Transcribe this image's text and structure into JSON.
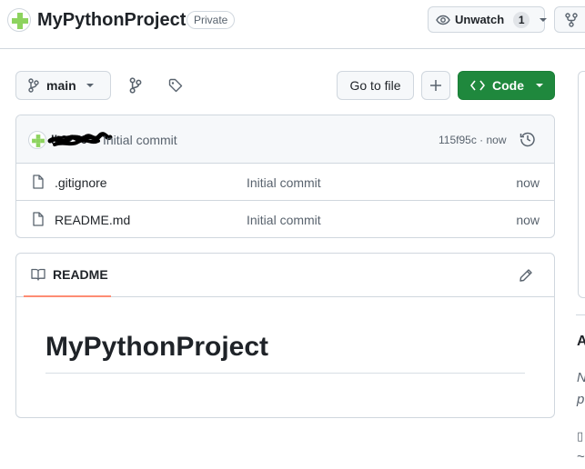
{
  "repo": {
    "name": "MyPythonProject",
    "visibility": "Private"
  },
  "header": {
    "unwatch_label": "Unwatch",
    "watch_count": "1"
  },
  "toolbar": {
    "branch": "main",
    "go_to_file_label": "Go to file",
    "add_label": "+",
    "code_label": "Code"
  },
  "latest_commit": {
    "author": "lk2256",
    "message": "Initial commit",
    "meta": "115f95c · now"
  },
  "files": [
    {
      "name": ".gitignore",
      "message": "Initial commit",
      "time": "now"
    },
    {
      "name": "README.md",
      "message": "Initial commit",
      "time": "now"
    }
  ],
  "readme": {
    "tab_label": "README",
    "heading": "MyPythonProject"
  },
  "sidebar": {
    "about_fragment": "A",
    "desc_line_1": "N",
    "desc_line_2": "p",
    "readme_glyph": "▯",
    "activity_glyph": "~"
  },
  "colors": {
    "primary_green": "#1f883d",
    "tab_underline": "#fd8c73",
    "border": "#d0d7de",
    "muted_text": "#59636e"
  }
}
